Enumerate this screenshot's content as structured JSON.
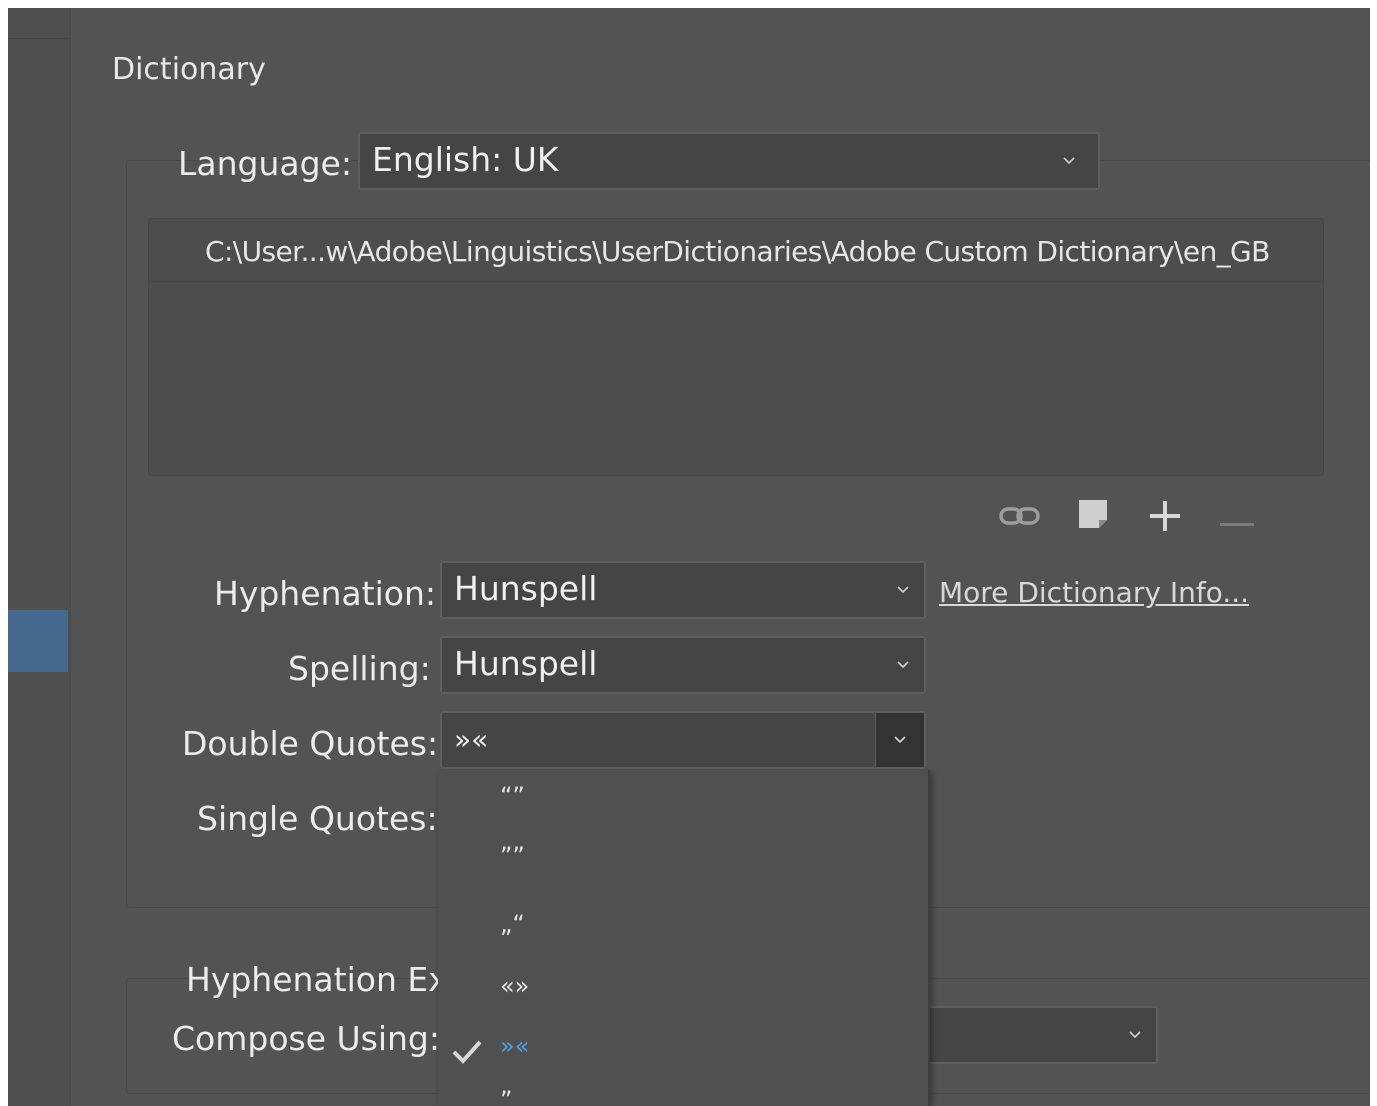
{
  "section": {
    "title": "Dictionary"
  },
  "language": {
    "label": "Language:",
    "value": "English: UK"
  },
  "dictionary_list": {
    "paths": [
      "C:\\User...w\\Adobe\\Linguistics\\UserDictionaries\\Adobe Custom Dictionary\\en_GB"
    ]
  },
  "toolbar": {
    "icons": [
      "link-icon",
      "new-dictionary-icon",
      "add-icon",
      "remove-icon"
    ]
  },
  "hyphenation": {
    "label": "Hyphenation:",
    "value": "Hunspell",
    "more_link": "More Dictionary Info..."
  },
  "spelling": {
    "label": "Spelling:",
    "value": "Hunspell"
  },
  "double_quotes": {
    "label": "Double Quotes:",
    "value": "»«",
    "options": [
      "“”",
      "””",
      "„“",
      "«»",
      "»«",
      "”"
    ],
    "selected_index": 4
  },
  "single_quotes": {
    "label": "Single Quotes:"
  },
  "hyphenation_exceptions": {
    "title": "Hyphenation Exc"
  },
  "compose": {
    "label": "Compose Using:"
  },
  "colors": {
    "background": "#535353",
    "field": "#454545",
    "accent_selected": "#4ba3e8",
    "sidebar_selected": "#46698f"
  }
}
